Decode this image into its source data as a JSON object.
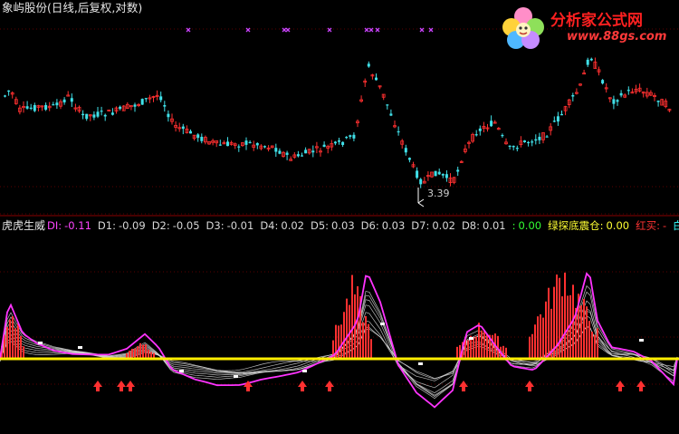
{
  "header": {
    "title": "象屿股份(日线,后复权,对数)"
  },
  "price_panel": {
    "low_label": "3.39"
  },
  "indicator": {
    "name": "虎虎生威",
    "items": [
      {
        "label": "DI:",
        "value": "-0.11",
        "color": "#ff44ff"
      },
      {
        "label": "D1:",
        "value": "-0.09",
        "color": "#d8d8d8"
      },
      {
        "label": "D2:",
        "value": "-0.05",
        "color": "#d8d8d8"
      },
      {
        "label": "D3:",
        "value": "-0.01",
        "color": "#d8d8d8"
      },
      {
        "label": "D4:",
        "value": "0.02",
        "color": "#d8d8d8"
      },
      {
        "label": "D5:",
        "value": "0.03",
        "color": "#d8d8d8"
      },
      {
        "label": "D6:",
        "value": "0.03",
        "color": "#d8d8d8"
      },
      {
        "label": "D7:",
        "value": "0.02",
        "color": "#d8d8d8"
      },
      {
        "label": "D8:",
        "value": "0.01",
        "color": "#d8d8d8"
      },
      {
        "label": ":",
        "value": "0.00",
        "color": "#33ff33"
      },
      {
        "label": "绿探底震仓:",
        "value": "0.00",
        "color": "#ffff33"
      },
      {
        "label": "红买:",
        "value": "-",
        "color": "#ff3333"
      },
      {
        "label": "白卖:",
        "value": "-",
        "color": "#33ffff"
      }
    ]
  },
  "logo": {
    "name": "分析家公式网",
    "url_text": "www.88gs.com"
  },
  "colors": {
    "up": "#ff3030",
    "down": "#40e0e8",
    "baseline": "#ffee00",
    "di_line": "#ff33ff",
    "marker": "#cc44ff",
    "arrow": "#ff3030"
  }
}
